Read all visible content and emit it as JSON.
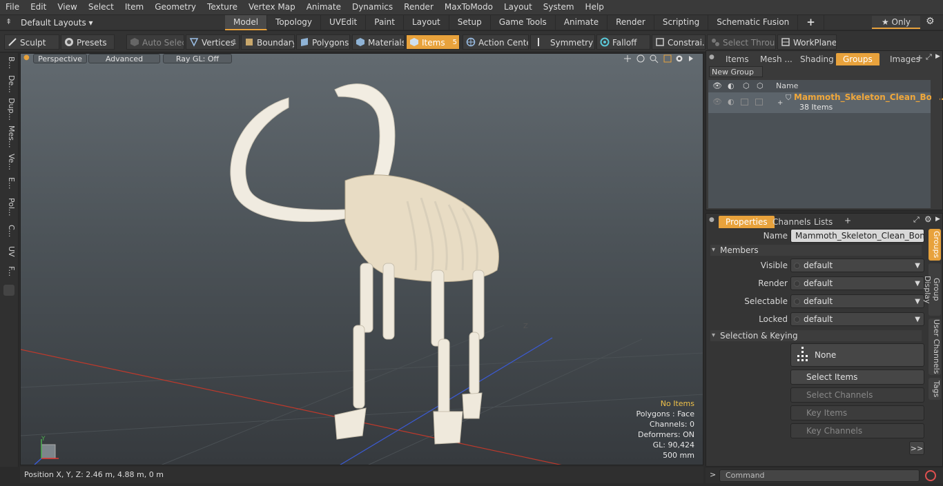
{
  "menu": [
    "File",
    "Edit",
    "View",
    "Select",
    "Item",
    "Geometry",
    "Texture",
    "Vertex Map",
    "Animate",
    "Dynamics",
    "Render",
    "MaxToModo",
    "Layout",
    "System",
    "Help"
  ],
  "layout": {
    "dropdown": "Default Layouts ▾",
    "tabs": [
      "Model",
      "Topology",
      "UVEdit",
      "Paint",
      "Layout",
      "Setup",
      "Game Tools",
      "Animate",
      "Render",
      "Scripting",
      "Schematic Fusion"
    ],
    "active_tab": "Model",
    "add": "+",
    "only": "★  Only",
    "gear": "⚙"
  },
  "toolbar": {
    "sculpt": "Sculpt",
    "presets": "Presets",
    "auto_select": "Auto Select",
    "vertices": "Vertices",
    "vertices_count": "1",
    "boundary": "Boundary",
    "polygons": "Polygons",
    "materials": "Materials",
    "items": "Items",
    "items_count": "5",
    "action_center": "Action Center",
    "symmetry": "Symmetry",
    "falloff": "Falloff",
    "constrain": "Constrai...",
    "select_through": "Select Through",
    "workplane": "WorkPlane"
  },
  "left_tabs": [
    "B...",
    "De...",
    "Dup...",
    "Mes...",
    "Ve...",
    "E...",
    "Pol...",
    "C...",
    "UV",
    "F..."
  ],
  "viewport": {
    "perspective": "Perspective",
    "advanced": "Advanced",
    "raygl": "Ray GL: Off",
    "info": {
      "selection": "No Items",
      "polygons": "Polygons : Face",
      "channels": "Channels: 0",
      "deformers": "Deformers: ON",
      "gl": "GL: 90,424",
      "scale": "500 mm"
    },
    "axis_y": "Y",
    "axis_z": "Z"
  },
  "status": "Position X, Y, Z:   2.46 m, 4.88 m, 0 m",
  "groups_panel": {
    "tabs": [
      "Items",
      "Mesh ...",
      "Shading",
      "Groups",
      "Images"
    ],
    "active": "Groups",
    "new_group": "New Group",
    "col_name": "Name",
    "group_name": "Mammoth_Skeleton_Clean_Bon...",
    "group_count": "38 Items"
  },
  "props_panel": {
    "tabs": [
      "Properties",
      "Channels",
      "Lists"
    ],
    "active": "Properties",
    "name_label": "Name",
    "name_value": "Mammoth_Skeleton_Clean_Bones_Sta",
    "members": "Members",
    "fields": [
      {
        "label": "Visible",
        "value": "default"
      },
      {
        "label": "Render",
        "value": "default"
      },
      {
        "label": "Selectable",
        "value": "default"
      },
      {
        "label": "Locked",
        "value": "default"
      }
    ],
    "selection_keying": "Selection & Keying",
    "none": "None",
    "select_items": "Select Items",
    "select_channels": "Select Channels",
    "key_items": "Key Items",
    "key_channels": "Key Channels",
    "more": ">>",
    "side_tabs": [
      "Groups",
      "Group Display",
      "User Channels",
      "Tags"
    ]
  },
  "command": {
    "prompt": ">",
    "placeholder": "Command"
  }
}
